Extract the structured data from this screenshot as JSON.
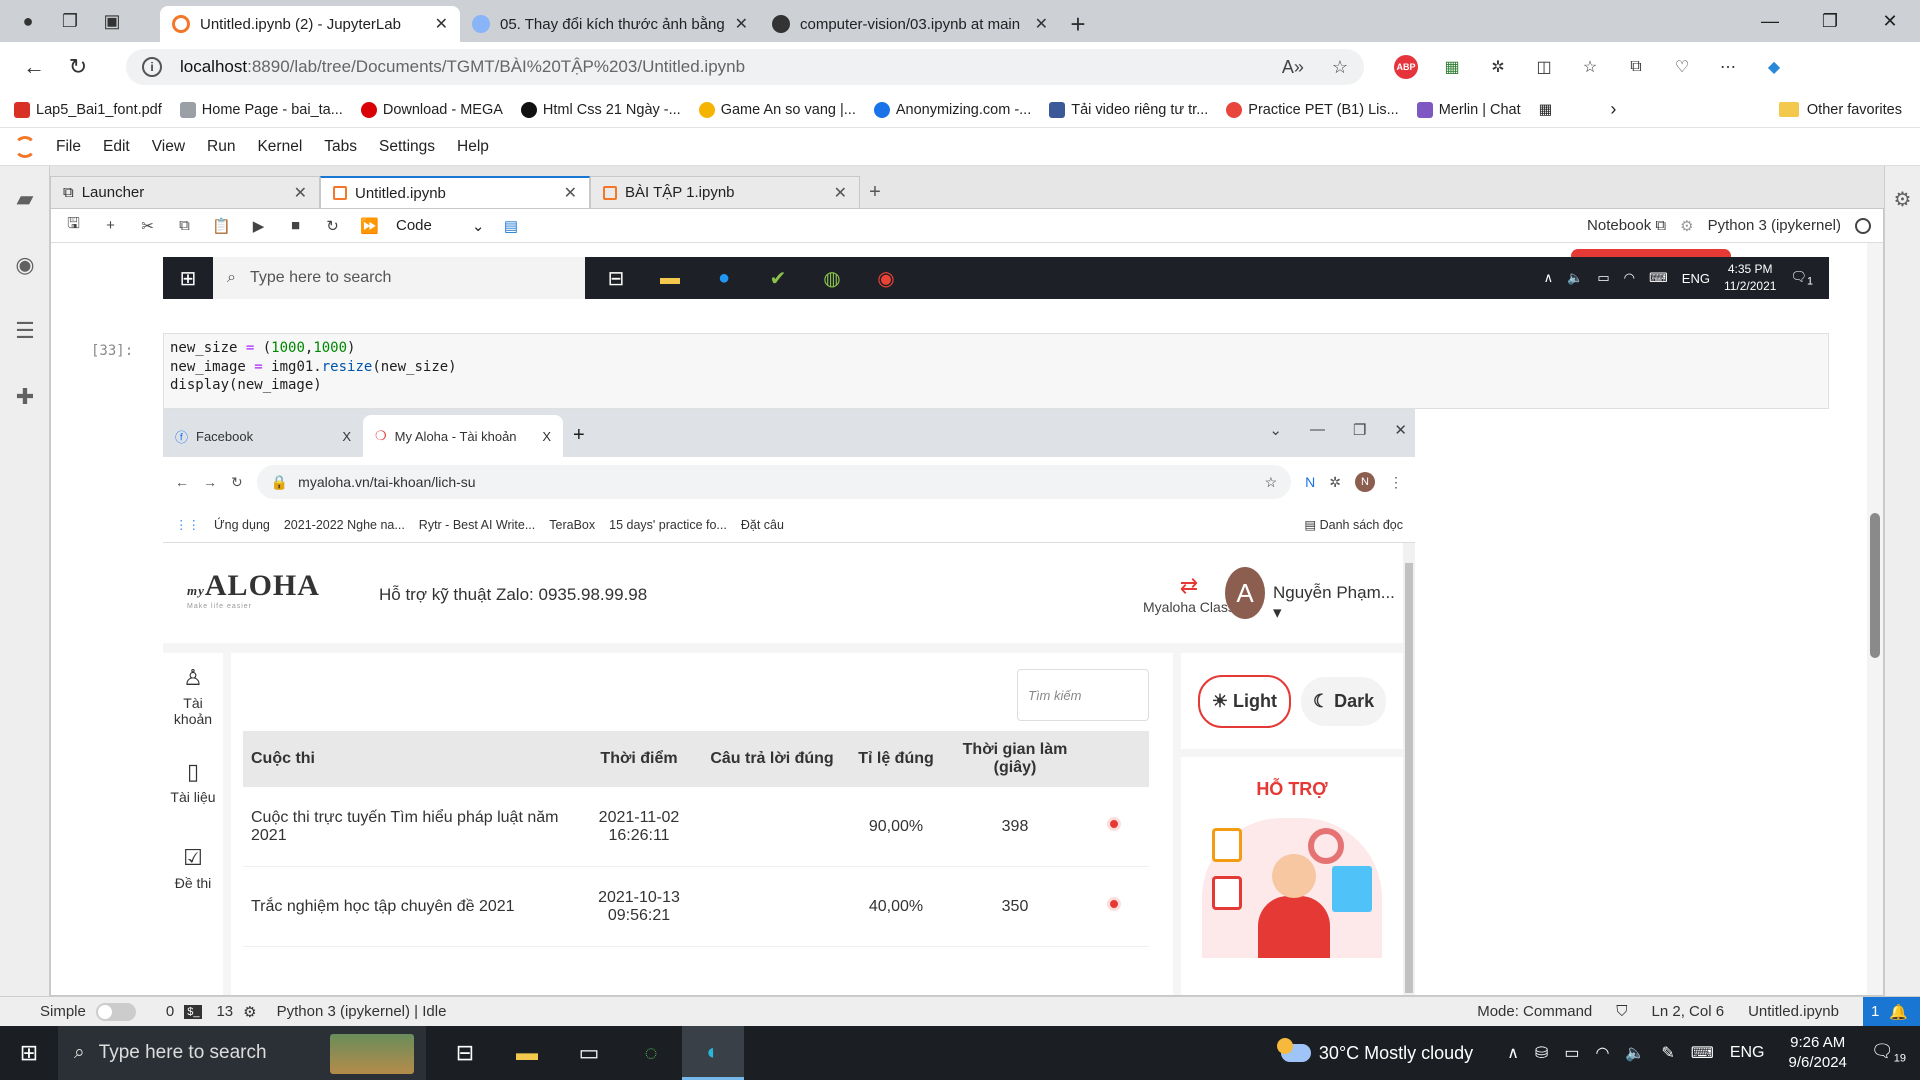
{
  "browser": {
    "tabs": [
      {
        "title": "Untitled.ipynb (2) - JupyterLab",
        "active": true,
        "favicon_color": "#f37726"
      },
      {
        "title": "05. Thay đổi kích thước ảnh bằng",
        "active": false,
        "favicon_color": "#8ab4f8"
      },
      {
        "title": "computer-vision/03.ipynb at main",
        "active": false,
        "favicon_color": "#333333"
      }
    ],
    "url_host": "localhost",
    "url_rest": ":8890/lab/tree/Documents/TGMT/BÀI%20TẬP%203/Untitled.ipynb",
    "bookmarks": [
      {
        "label": "Lap5_Bai1_font.pdf",
        "color": "#d93025"
      },
      {
        "label": "Home Page - bai_ta...",
        "color": "#9aa0a6"
      },
      {
        "label": "Download - MEGA",
        "color": "#d90007"
      },
      {
        "label": "Html Css 21 Ngày -...",
        "color": "#111111"
      },
      {
        "label": "Game An so vang |...",
        "color": "#f4b400"
      },
      {
        "label": "Anonymizing.com -...",
        "color": "#1a73e8"
      },
      {
        "label": "Tải video riêng tư tr...",
        "color": "#3b5998"
      },
      {
        "label": "Practice PET (B1) Lis...",
        "color": "#e8453c"
      },
      {
        "label": "Merlin | Chat",
        "color": "#7e57c2"
      }
    ],
    "other_favorites": "Other favorites"
  },
  "jupyter": {
    "menu": [
      "File",
      "Edit",
      "View",
      "Run",
      "Kernel",
      "Tabs",
      "Settings",
      "Help"
    ],
    "tabs": [
      {
        "title": "Launcher",
        "active": false
      },
      {
        "title": "Untitled.ipynb",
        "active": true
      },
      {
        "title": "BÀI TẬP 1.ipynb",
        "active": false
      }
    ],
    "cell_type": "Code",
    "notebook_label": "Notebook",
    "kernel": "Python 3 (ipykernel)",
    "prompt": "[33]:",
    "code": {
      "line1_a": "new_size ",
      "line1_op": "=",
      "line1_b": " (",
      "line1_n1": "1000",
      "line1_c": ",",
      "line1_n2": "1000",
      "line1_d": ")",
      "line2_a": "new_image ",
      "line2_op": "=",
      "line2_b": " img01.",
      "line2_fn": "resize",
      "line2_c": "(new_size)",
      "line3": "display(new_image)"
    },
    "status": {
      "mode_label": "Simple",
      "count_a": "0",
      "count_b": "13",
      "kernel_status": "Python 3 (ipykernel) | Idle",
      "mode": "Mode: Command",
      "cursor": "Ln 2, Col 6",
      "filename": "Untitled.ipynb",
      "notifications": "1"
    }
  },
  "prev_output_taskbar": {
    "search": "Type here to search",
    "lang": "ENG",
    "time": "4:35 PM",
    "date": "11/2/2021",
    "badge": "1"
  },
  "output_image": {
    "tabs": [
      {
        "title": "Facebook",
        "active": false
      },
      {
        "title": "My Aloha - Tài khoản",
        "active": true
      }
    ],
    "url": "myaloha.vn/tai-khoan/lich-su",
    "bookmarks": [
      "Ứng dụng",
      "2021-2022 Nghe na...",
      "Rytr - Best AI Write...",
      "TeraBox",
      "15 days' practice fo...",
      "Đặt câu"
    ],
    "reading_list": "Danh sách đọc",
    "logo_text": "ALOHA",
    "logo_prefix": "my",
    "logo_tagline": "Make life easier",
    "support": "Hỗ trợ kỹ thuật Zalo: 0935.98.99.98",
    "myaloha_class": "Myaloha Class",
    "avatar_letter": "A",
    "user_name": "Nguyễn Phạm...",
    "sidebar": [
      "Tài khoản",
      "Tài liệu",
      "Đề thi"
    ],
    "search_placeholder": "Tìm kiếm",
    "table": {
      "headers": [
        "Cuộc thi",
        "Thời điểm",
        "Câu trả lời đúng",
        "Tỉ lệ đúng",
        "Thời gian làm (giây)"
      ],
      "rows": [
        [
          "Cuộc thi trực tuyến Tìm hiểu pháp luật năm 2021",
          "2021-11-02 16:26:11",
          "",
          "90,00%",
          "398"
        ],
        [
          "Trắc nghiệm học tập chuyên đề 2021",
          "2021-10-13 09:56:21",
          "",
          "40,00%",
          "350"
        ]
      ]
    },
    "theme_light": "Light",
    "theme_dark": "Dark",
    "support_heading": "HỖ TRỢ"
  },
  "taskbar": {
    "search": "Type here to search",
    "weather": "30°C  Mostly cloudy",
    "lang": "ENG",
    "time": "9:26 AM",
    "date": "9/6/2024",
    "badge": "19"
  }
}
